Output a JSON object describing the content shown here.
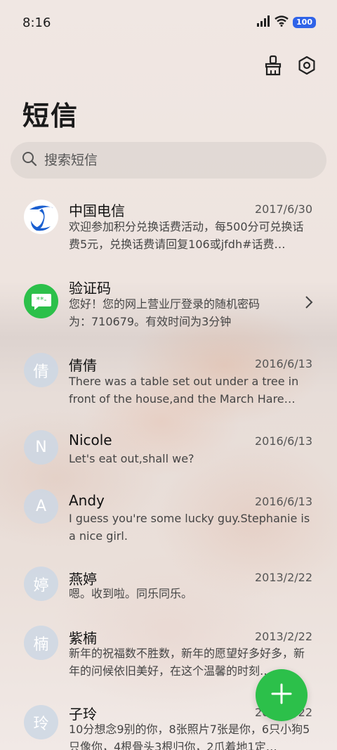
{
  "status": {
    "time": "8:16",
    "battery": "100"
  },
  "page": {
    "title": "短信"
  },
  "search": {
    "placeholder": "搜索短信"
  },
  "conversations": [
    {
      "name": "中国电信",
      "date": "2017/6/30",
      "preview": "欢迎参加积分兑换话费活动，每500分可兑换话费5元，兑换话费请回复106或jfdh#话费…",
      "avatar": "telecom-logo"
    },
    {
      "name": "验证码",
      "date": "",
      "preview": "您好！您的网上营业厅登录的随机密码为：710679。有效时间为3分钟",
      "avatar": "message-icon"
    },
    {
      "name": "倩倩",
      "date": "2016/6/13",
      "preview": "There was a table set out under a tree in front of the house,and the March Hare an…",
      "avatar_text": "倩"
    },
    {
      "name": "Nicole",
      "date": "2016/6/13",
      "preview": "Let's eat out,shall we?",
      "avatar_text": "N"
    },
    {
      "name": "Andy",
      "date": "2016/6/13",
      "preview": "I guess you're some lucky guy.Stephanie is a nice girl.",
      "avatar_text": "A"
    },
    {
      "name": "燕婷",
      "date": "2013/2/22",
      "preview": "嗯。收到啦。同乐同乐。",
      "avatar_text": "婷"
    },
    {
      "name": "紫楠",
      "date": "2013/2/22",
      "preview": "新年的祝福数不胜数，新年的愿望好多好多，新年的问候依旧美好，在这个温馨的时刻…",
      "avatar_text": "楠"
    },
    {
      "name": "子玲",
      "date": "2013/2/22",
      "preview": "10分想念9别的你，8张照片7张是你，6只小狗5只像你，4根骨头3根归你，2爪着地1定…",
      "avatar_text": "玲"
    }
  ],
  "colors": {
    "accent": "#2cc04a",
    "telecom_blue": "#1a5fd0",
    "battery": "#2f63e8"
  }
}
